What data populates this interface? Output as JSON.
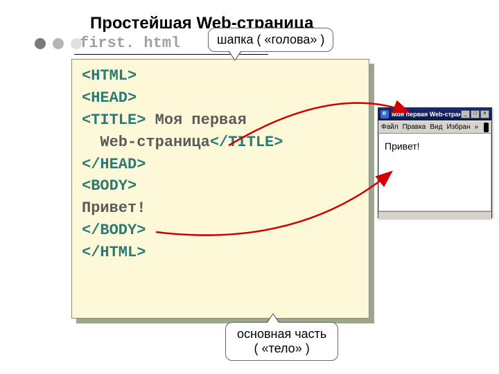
{
  "title": "Простейшая Web-страница",
  "filename": "first. html",
  "callout_top": "шапка ( «голова» )",
  "callout_bottom_l1": "основная часть",
  "callout_bottom_l2": "( «тело» )",
  "code": {
    "l1": "<HTML>",
    "l2": "<HEAD>",
    "l3a": "<TITLE>",
    "l3b": " Моя первая",
    "l4a": "  Web-страница",
    "l4b": "</TITLE>",
    "l5": "</HEAD>",
    "l6": "<BODY>",
    "l7": "Привет!",
    "l8": "</BODY>",
    "l9": "</HTML>"
  },
  "browser": {
    "title": "Моя первая Web-страница ...",
    "menu": {
      "file": "Файл",
      "edit": "Правка",
      "view": "Вид",
      "fav": "Избран"
    },
    "chev": "»",
    "body": "Привет!",
    "min": "_",
    "max": "□",
    "close": "×"
  }
}
